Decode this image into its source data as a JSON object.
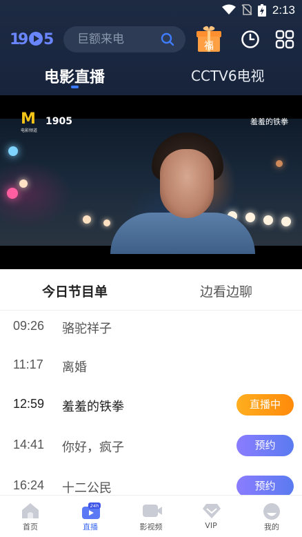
{
  "status_bar": {
    "time": "2:13"
  },
  "header": {
    "logo_text": "1905",
    "search_placeholder": "巨额来电",
    "gift_badge": "福",
    "tabs": [
      {
        "label": "电影直播",
        "active": true
      },
      {
        "label": "CCTV6电视",
        "active": false
      }
    ]
  },
  "video": {
    "watermark_logo": "M",
    "watermark_logo_sub": "电影频道",
    "watermark_brand": "1905",
    "watermark_title": "羞羞的铁拳"
  },
  "program_tabs": [
    {
      "label": "今日节目单",
      "active": true
    },
    {
      "label": "边看边聊",
      "active": false
    }
  ],
  "schedule": [
    {
      "time": "09:26",
      "title": "骆驼祥子",
      "status": "",
      "badge_label": ""
    },
    {
      "time": "11:17",
      "title": "离婚",
      "status": "",
      "badge_label": ""
    },
    {
      "time": "12:59",
      "title": "羞羞的铁拳",
      "status": "live",
      "badge_label": "直播中"
    },
    {
      "time": "14:41",
      "title": "你好，疯子",
      "status": "book",
      "badge_label": "预约"
    },
    {
      "time": "16:24",
      "title": "十二公民",
      "status": "book",
      "badge_label": "预约"
    }
  ],
  "bottom_nav": [
    {
      "label": "首页",
      "icon": "home-icon",
      "active": false
    },
    {
      "label": "直播",
      "icon": "live-tv-icon",
      "active": true,
      "badge": "24h"
    },
    {
      "label": "影视频",
      "icon": "video-icon",
      "active": false
    },
    {
      "label": "VIP",
      "icon": "vip-diamond-icon",
      "active": false
    },
    {
      "label": "我的",
      "icon": "profile-icon",
      "active": false
    }
  ],
  "colors": {
    "header_bg": "#1d2a42",
    "accent_blue": "#3f6cf3",
    "live_orange": "#ff9a14",
    "book_purple": "#7b7cf8"
  }
}
